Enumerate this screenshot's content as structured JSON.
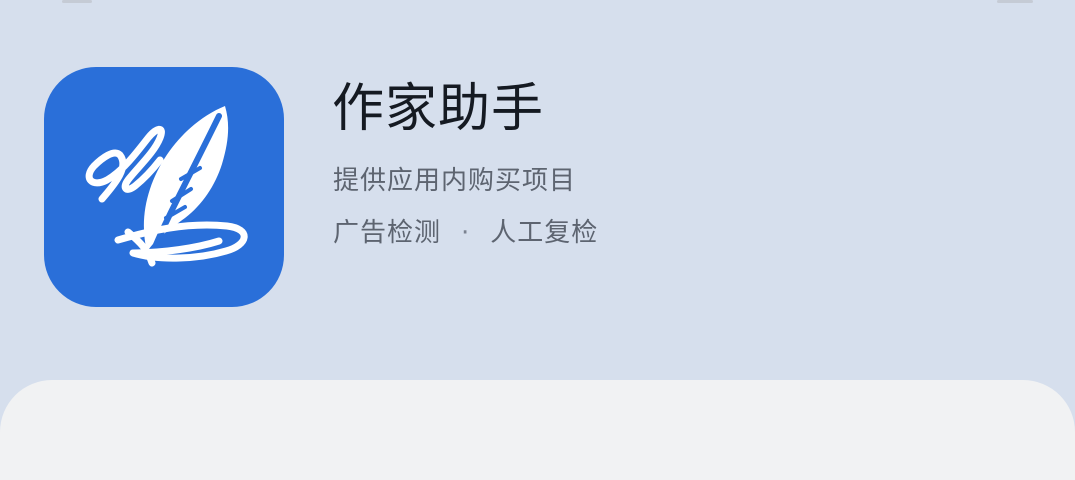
{
  "app": {
    "name": "作家助手",
    "purchase_note": "提供应用内购买项目",
    "tags": [
      "广告检测",
      "人工复检"
    ],
    "tag_separator": "·",
    "icon": "writing-quill-icon",
    "icon_color": "#2a6fd9"
  },
  "theme": {
    "background": "#d6dfed",
    "card_background": "#f1f2f3",
    "title_color": "#151a22",
    "secondary_text_color": "#5d6470"
  }
}
